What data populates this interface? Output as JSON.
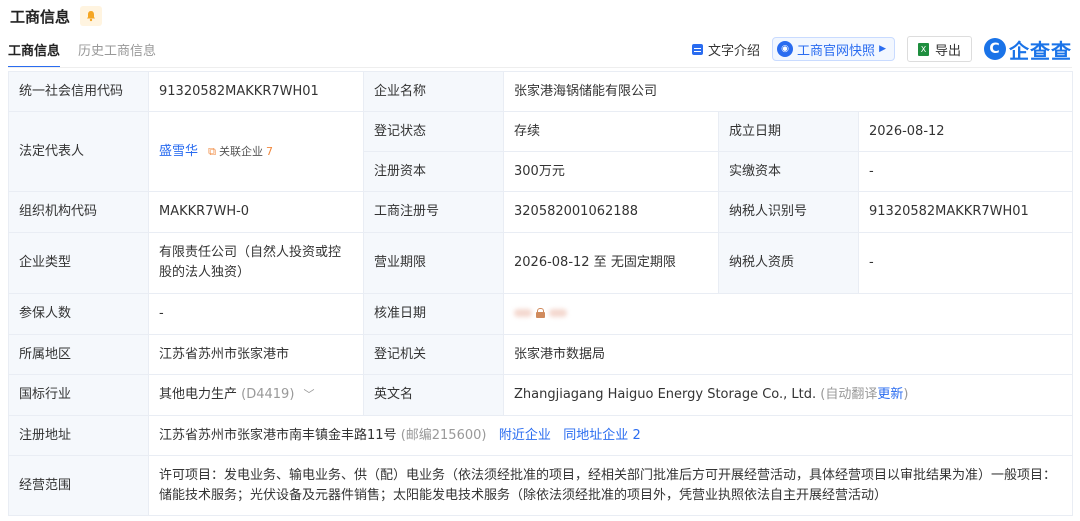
{
  "header": {
    "title": "工商信息",
    "bell_icon": "bell-icon"
  },
  "tabs": [
    {
      "label": "工商信息",
      "active": true
    },
    {
      "label": "历史工商信息",
      "active": false
    }
  ],
  "actions": {
    "text_intro": "文字介绍",
    "official_snapshot": "工商官网快照",
    "export": "导出",
    "brand": "企查查",
    "brand_logo_char": "C"
  },
  "rows": {
    "credit_code_label": "统一社会信用代码",
    "credit_code_value": "91320582MAKKR7WH01",
    "company_name_label": "企业名称",
    "company_name_value": "张家港海锅储能有限公司",
    "legal_rep_label": "法定代表人",
    "legal_rep_value": "盛雪华",
    "related_label": "关联企业",
    "related_count": "7",
    "reg_status_label": "登记状态",
    "reg_status_value": "存续",
    "founded_label": "成立日期",
    "founded_value": "2026-08-12",
    "reg_capital_label": "注册资本",
    "reg_capital_value": "300万元",
    "paid_capital_label": "实缴资本",
    "paid_capital_value": "-",
    "org_code_label": "组织机构代码",
    "org_code_value": "MAKKR7WH-0",
    "biz_reg_no_label": "工商注册号",
    "biz_reg_no_value": "320582001062188",
    "taxpayer_id_label": "纳税人识别号",
    "taxpayer_id_value": "91320582MAKKR7WH01",
    "company_type_label": "企业类型",
    "company_type_value": "有限责任公司（自然人投资或控股的法人独资）",
    "term_label": "营业期限",
    "term_value": "2026-08-12 至 无固定期限",
    "taxpayer_qual_label": "纳税人资质",
    "taxpayer_qual_value": "-",
    "insured_label": "参保人数",
    "insured_value": "-",
    "approval_date_label": "核准日期",
    "region_label": "所属地区",
    "region_value": "江苏省苏州市张家港市",
    "reg_authority_label": "登记机关",
    "reg_authority_value": "张家港市数据局",
    "industry_label": "国标行业",
    "industry_value": "其他电力生产",
    "industry_code": "(D4419)",
    "english_name_label": "英文名",
    "english_name_value": "Zhangjiagang Haiguo Energy Storage Co., Ltd.",
    "auto_translate": "(自动翻译",
    "update_link": "更新",
    "auto_translate_close": ")",
    "address_label": "注册地址",
    "address_value": "江苏省苏州市张家港市南丰镇金丰路11号",
    "postcode": "(邮编215600)",
    "nearby_link": "附近企业",
    "same_address_link": "同地址企业",
    "same_address_count": "2",
    "scope_label": "经营范围",
    "scope_value": "许可项目：发电业务、输电业务、供（配）电业务（依法须经批准的项目，经相关部门批准后方可开展经营活动，具体经营项目以审批结果为准）一般项目：储能技术服务；光伏设备及元器件销售；太阳能发电技术服务（除依法须经批准的项目外，凭营业执照依法自主开展经营活动）"
  }
}
